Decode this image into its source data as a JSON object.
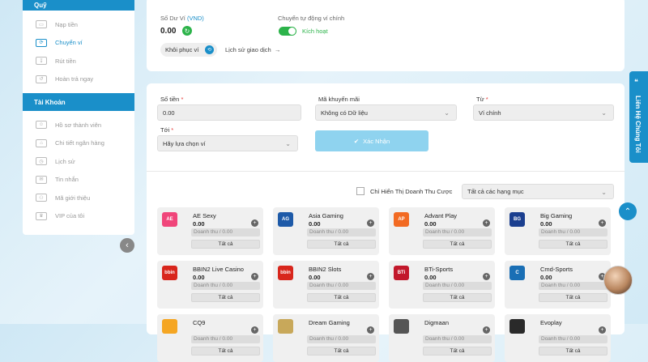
{
  "sidebar": {
    "top_header": "Quỹ",
    "fund_items": [
      {
        "label": "Nạp tiền",
        "icon": "wallet-icon"
      },
      {
        "label": "Chuyển ví",
        "icon": "transfer-icon"
      },
      {
        "label": "Rút tiền",
        "icon": "withdraw-icon"
      },
      {
        "label": "Hoàn trả ngay",
        "icon": "rebate-icon"
      }
    ],
    "account_header": "Tài Khoản",
    "account_items": [
      {
        "label": "Hồ sơ thành viên",
        "icon": "profile-icon"
      },
      {
        "label": "Chi tiết ngân hàng",
        "icon": "bank-icon"
      },
      {
        "label": "Lịch sử",
        "icon": "history-icon"
      },
      {
        "label": "Tin nhắn",
        "icon": "message-icon"
      },
      {
        "label": "Mã giới thiệu",
        "icon": "referral-icon"
      },
      {
        "label": "VIP của tôi",
        "icon": "vip-icon"
      }
    ],
    "collapse_symbol": "‹"
  },
  "wallet": {
    "balance_label": "Số Dư Ví ",
    "currency": "(VND)",
    "balance": "0.00",
    "auto_transfer_label": "Chuyển tự động ví chính",
    "auto_transfer_state": "Kích hoạt",
    "auto_transfer_on": true,
    "restore_label": "Khôi phục ví",
    "history_label": "Lịch sử giao dịch",
    "history_arrow": "→"
  },
  "transfer_form": {
    "amount_label": "Số tiền",
    "amount_value": "0.00",
    "promo_label": "Mã khuyến mãi",
    "promo_value": "Không có Dữ liệu",
    "from_label": "Từ",
    "from_value": "Ví chính",
    "to_label": "Tới",
    "to_value": "Hãy lựa chọn ví",
    "required_mark": "*",
    "confirm_label": "Xác Nhận",
    "confirm_check": "✔"
  },
  "filter": {
    "revenue_only_label": "Chỉ Hiển Thị Doanh Thu Cược",
    "category_value": "Tất cả các hạng mục"
  },
  "game_common": {
    "revenue_text": "Doanh thu / 0.00",
    "all_label": "Tất cả",
    "plus": "+"
  },
  "games": [
    {
      "name": "AE Sexy",
      "balance": "0.00",
      "logo": "AE",
      "color": "#f0457a"
    },
    {
      "name": "Asia Gaming",
      "balance": "0.00",
      "logo": "AG",
      "color": "#1e5aa8"
    },
    {
      "name": "Advant Play",
      "balance": "0.00",
      "logo": "AP",
      "color": "#f26a22"
    },
    {
      "name": "Big Gaming",
      "balance": "0.00",
      "logo": "BG",
      "color": "#1b3f8f"
    },
    {
      "name": "BBIN2 Live Casino",
      "balance": "0.00",
      "logo": "bbin",
      "color": "#d8261c"
    },
    {
      "name": "BBIN2 Slots",
      "balance": "0.00",
      "logo": "bbin",
      "color": "#d8261c"
    },
    {
      "name": "BTi-Sports",
      "balance": "0.00",
      "logo": "BTi",
      "color": "#c2182b"
    },
    {
      "name": "Cmd-Sports",
      "balance": "0.00",
      "logo": "C",
      "color": "#1a6fb5"
    },
    {
      "name": "CQ9",
      "balance": "",
      "logo": "",
      "color": "#f5a623"
    },
    {
      "name": "Dream Gaming",
      "balance": "",
      "logo": "",
      "color": "#c8a85a"
    },
    {
      "name": "Digmaan",
      "balance": "",
      "logo": "",
      "color": "#555555"
    },
    {
      "name": "Evoplay",
      "balance": "",
      "logo": "",
      "color": "#2a2a2a"
    }
  ],
  "contact_tab": {
    "label": "Liên Hệ Chúng Tôi",
    "icon": "chat-bubble-icon"
  },
  "scroll_top_symbol": "⌃",
  "colors": {
    "primary": "#1a8fc9",
    "success": "#2cb34a",
    "confirm_button": "#8fd3ef"
  }
}
